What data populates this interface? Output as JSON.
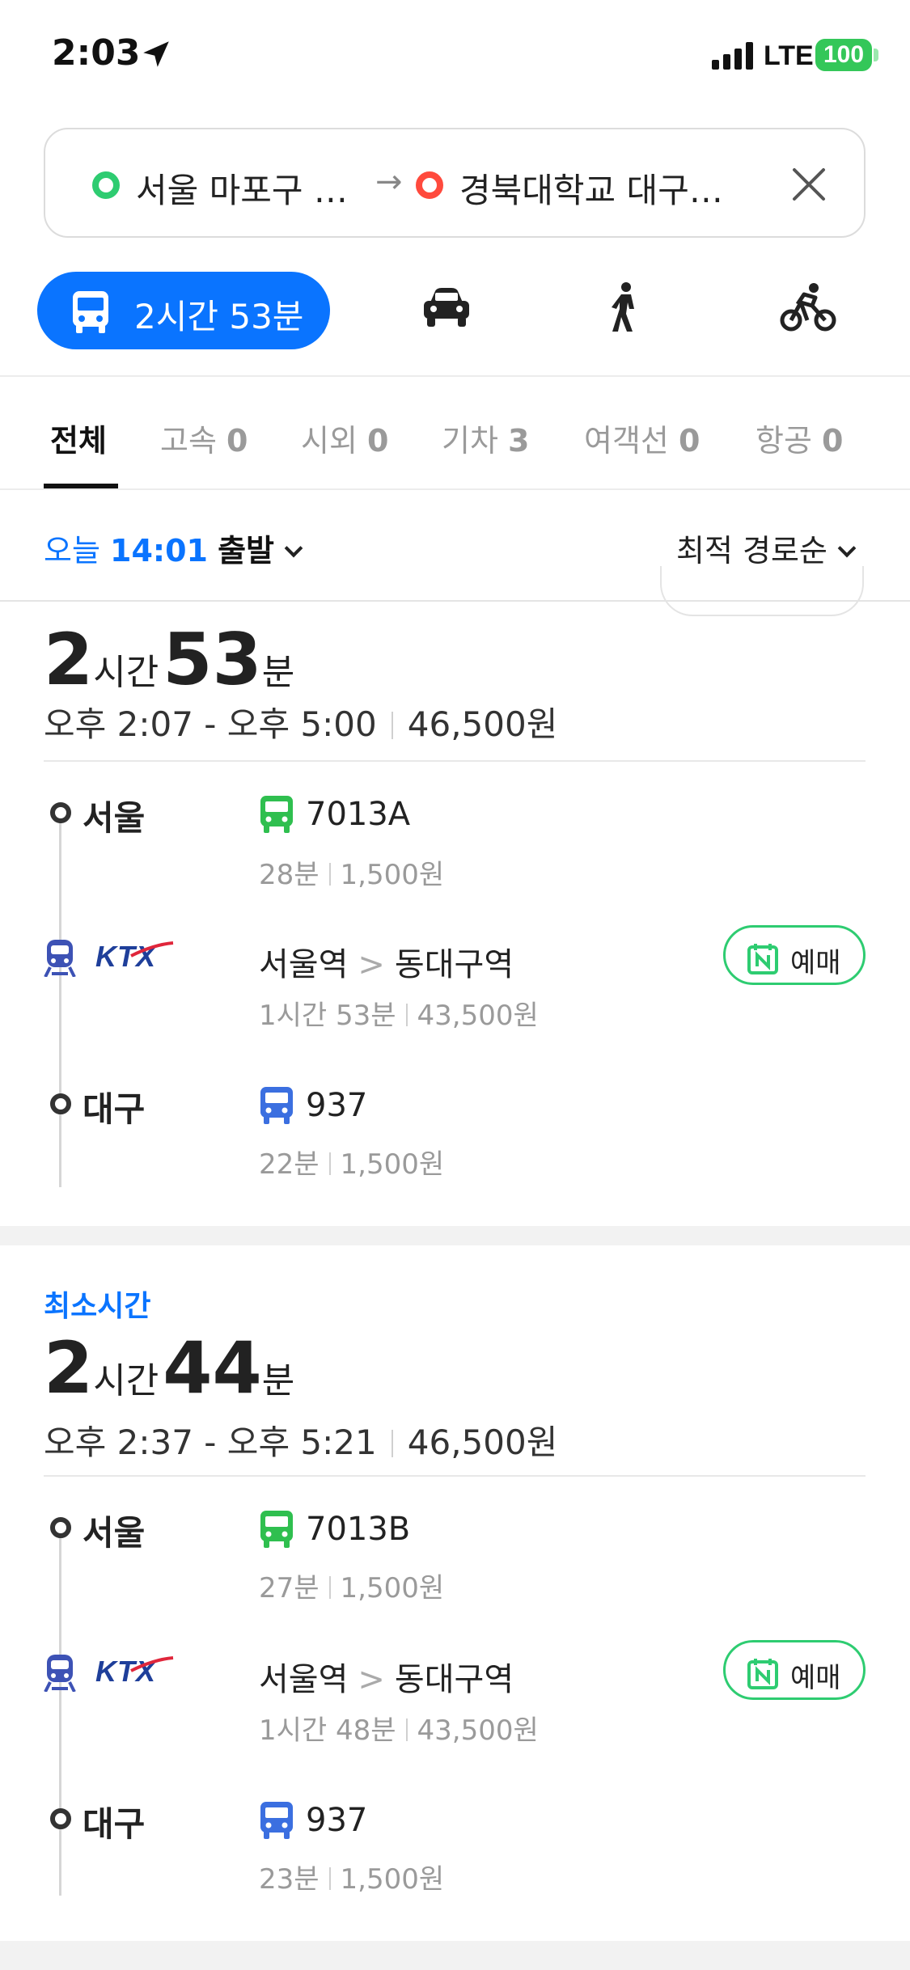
{
  "status_bar": {
    "time": "2:03",
    "network": "LTE",
    "battery": "100"
  },
  "route": {
    "origin": "서울 마포구 …",
    "arrow": "→",
    "destination": "경북대학교 대구…"
  },
  "modes": {
    "transit_duration": "2시간 53분"
  },
  "categories": [
    {
      "label": "전체",
      "count": ""
    },
    {
      "label": "고속",
      "count": "0"
    },
    {
      "label": "시외",
      "count": "0"
    },
    {
      "label": "기차",
      "count": "3"
    },
    {
      "label": "여객선",
      "count": "0"
    },
    {
      "label": "항공",
      "count": "0"
    }
  ],
  "depart": {
    "day": "오늘",
    "time": "14:01",
    "word": "출발"
  },
  "sort": {
    "label": "최적 경로순"
  },
  "routes": [
    {
      "badge": "",
      "hours": "2",
      "hour_unit": "시간",
      "minutes": "53",
      "minute_unit": "분",
      "time_range": "오후 2:07 - 오후 5:00",
      "price": "46,500원",
      "origin_stop": "서울",
      "bus1": {
        "name": "7013A",
        "time": "28분",
        "fare": "1,500원",
        "color": "#2fbf4f"
      },
      "rail": {
        "logo": "KTX",
        "from": "서울역",
        "gt": ">",
        "to": "동대구역",
        "time": "1시간 53분",
        "fare": "43,500원",
        "reserve_label": "예매"
      },
      "dest_stop": "대구",
      "bus2": {
        "name": "937",
        "time": "22분",
        "fare": "1,500원",
        "color": "#3b6fe0"
      }
    },
    {
      "badge": "최소시간",
      "hours": "2",
      "hour_unit": "시간",
      "minutes": "44",
      "minute_unit": "분",
      "time_range": "오후 2:37 - 오후 5:21",
      "price": "46,500원",
      "origin_stop": "서울",
      "bus1": {
        "name": "7013B",
        "time": "27분",
        "fare": "1,500원",
        "color": "#2fbf4f"
      },
      "rail": {
        "logo": "KTX",
        "from": "서울역",
        "gt": ">",
        "to": "동대구역",
        "time": "1시간 48분",
        "fare": "43,500원",
        "reserve_label": "예매"
      },
      "dest_stop": "대구",
      "bus2": {
        "name": "937",
        "time": "23분",
        "fare": "1,500원",
        "color": "#3b6fe0"
      }
    }
  ],
  "colors": {
    "accent": "#0a74ff",
    "origin_dot": "#2ecc71",
    "dest_dot": "#ff4a3d",
    "reserve_border": "#2ecc71"
  },
  "icons": [
    "location-arrow-icon",
    "signal-icon",
    "close-icon",
    "bus-icon",
    "car-icon",
    "walk-icon",
    "bike-icon",
    "chevron-down-icon",
    "train-icon",
    "naver-reserve-icon"
  ]
}
